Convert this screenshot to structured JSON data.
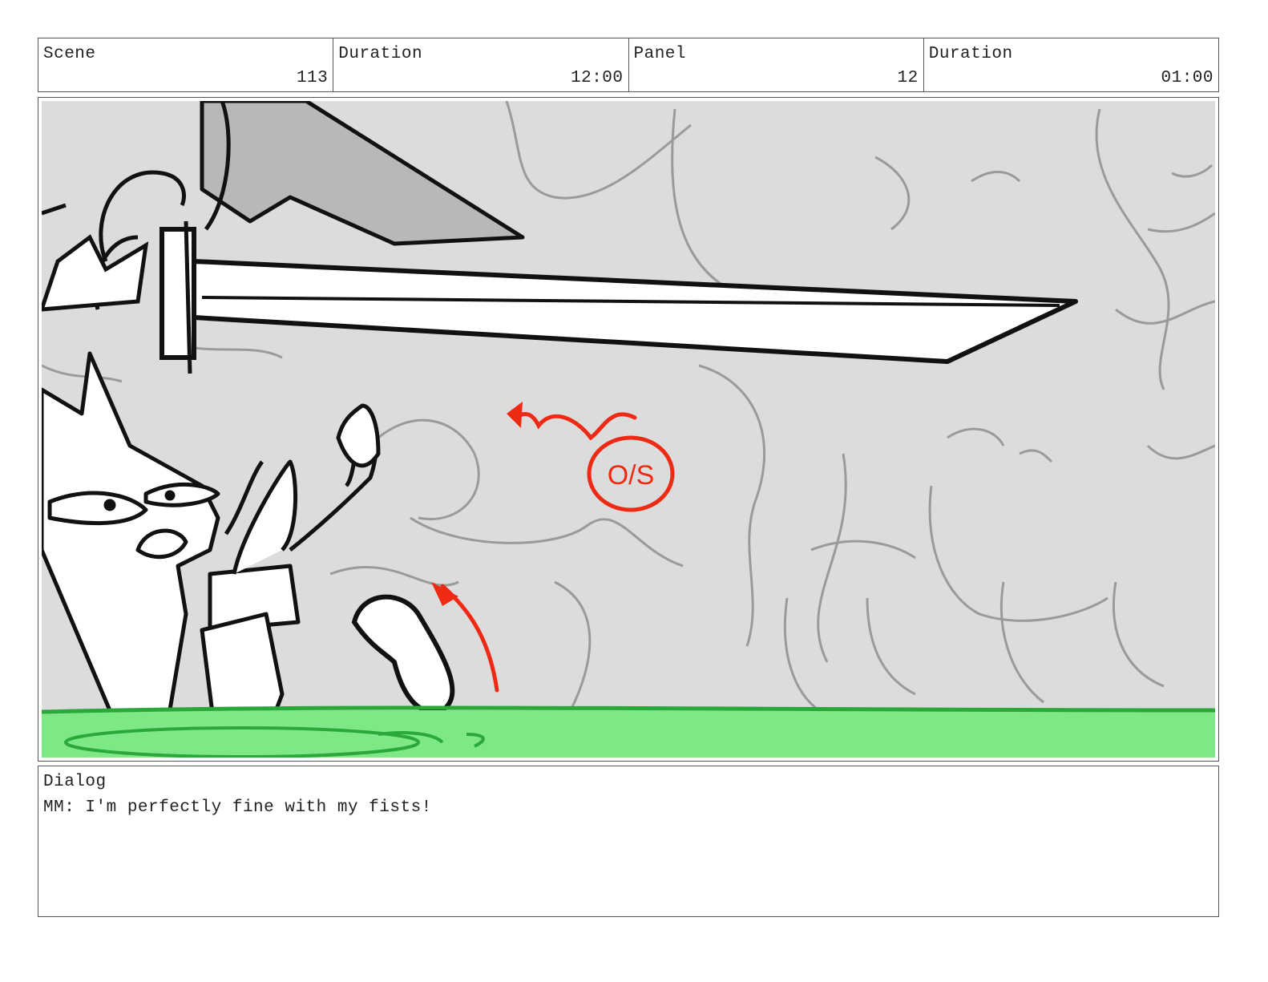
{
  "header": {
    "scene_label": "Scene",
    "scene_value": "113",
    "scene_duration_label": "Duration",
    "scene_duration_value": "12:00",
    "panel_label": "Panel",
    "panel_value": "12",
    "panel_duration_label": "Duration",
    "panel_duration_value": "01:00"
  },
  "artwork": {
    "annotation_text": "O/S",
    "colors": {
      "wall": "#dcdcdc",
      "wall_lines": "#9a9a9a",
      "slime": "#7ee887",
      "slime_edge": "#2aa83a",
      "annotation": "#ee2a14",
      "ink": "#111111"
    }
  },
  "dialog": {
    "label": "Dialog",
    "text": "MM: I'm perfectly fine with my fists!"
  }
}
